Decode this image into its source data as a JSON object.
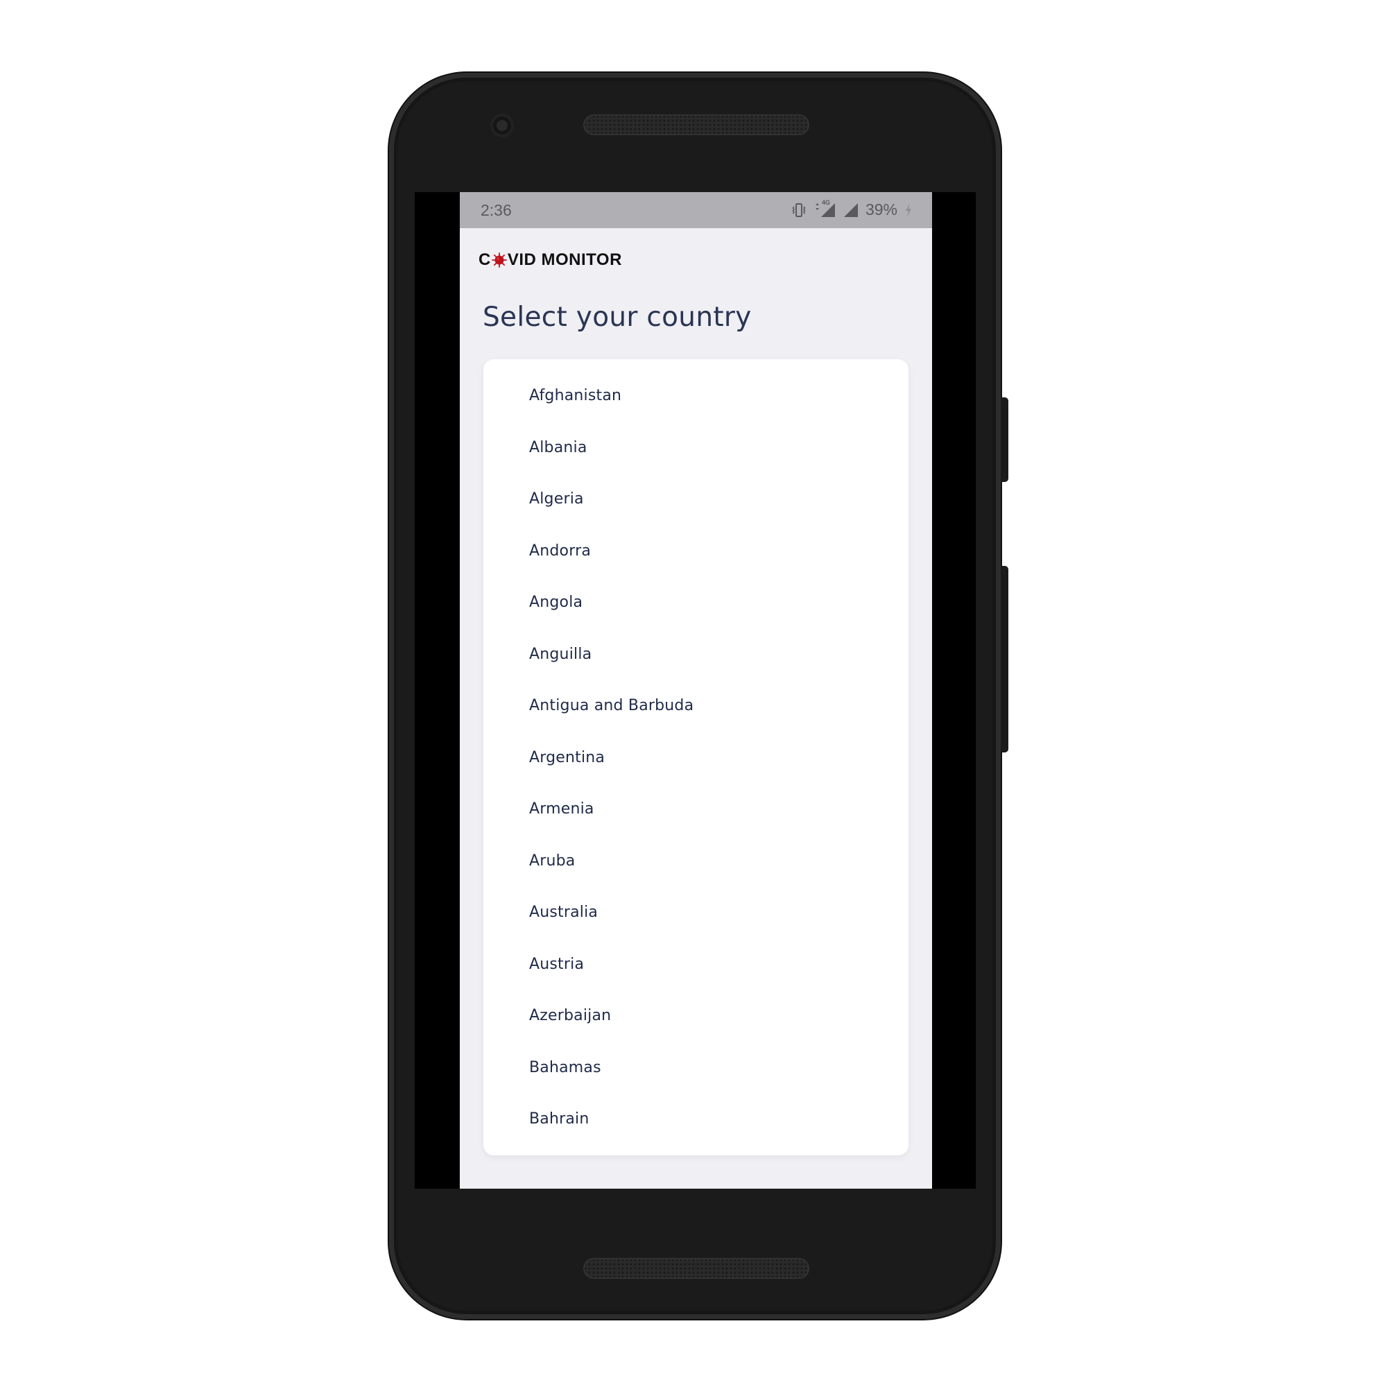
{
  "status_bar": {
    "time": "2:36",
    "network_label": "4G",
    "battery_percent": "39%"
  },
  "app": {
    "logo_prefix": "C",
    "logo_suffix": "VID MONITOR",
    "logo_virus_color": "#c0121c"
  },
  "page": {
    "title": "Select your country"
  },
  "countries": [
    "Afghanistan",
    "Albania",
    "Algeria",
    "Andorra",
    "Angola",
    "Anguilla",
    "Antigua and Barbuda",
    "Argentina",
    "Armenia",
    "Aruba",
    "Australia",
    "Austria",
    "Azerbaijan",
    "Bahamas",
    "Bahrain"
  ],
  "icons": {
    "vibrate": "vibrate-icon",
    "data": "mobile-data-icon",
    "signal": "cell-signal-icon",
    "charging": "charging-icon",
    "camera": "front-camera",
    "speaker": "speaker-grille"
  },
  "colors": {
    "title_text": "#2a3553",
    "list_text": "#1f2a48",
    "background": "#efeff4",
    "status_bar": "#b0b0b4"
  }
}
